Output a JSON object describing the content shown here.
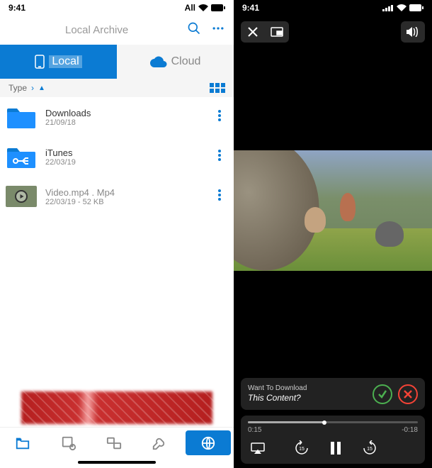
{
  "status_bar": {
    "time": "9:41",
    "carrier": "All"
  },
  "header": {
    "title": "Local Archive"
  },
  "tabs": {
    "local": "Local",
    "cloud": "Cloud"
  },
  "sort": {
    "label": "Type"
  },
  "files": [
    {
      "name": "Downloads",
      "meta": "21/09/18",
      "icon": "folder"
    },
    {
      "name": "iTunes",
      "meta": "22/03/19",
      "icon": "folder-usb"
    },
    {
      "name": "Video.mp4 . Mp4",
      "meta": "22/03/19 - 52 KB",
      "icon": "video"
    }
  ],
  "download_prompt": {
    "line1": "Want To Download",
    "line2": "This Content?"
  },
  "player": {
    "elapsed": "0:15",
    "remaining": "-0:18"
  },
  "colors": {
    "primary": "#0b7bd3"
  }
}
